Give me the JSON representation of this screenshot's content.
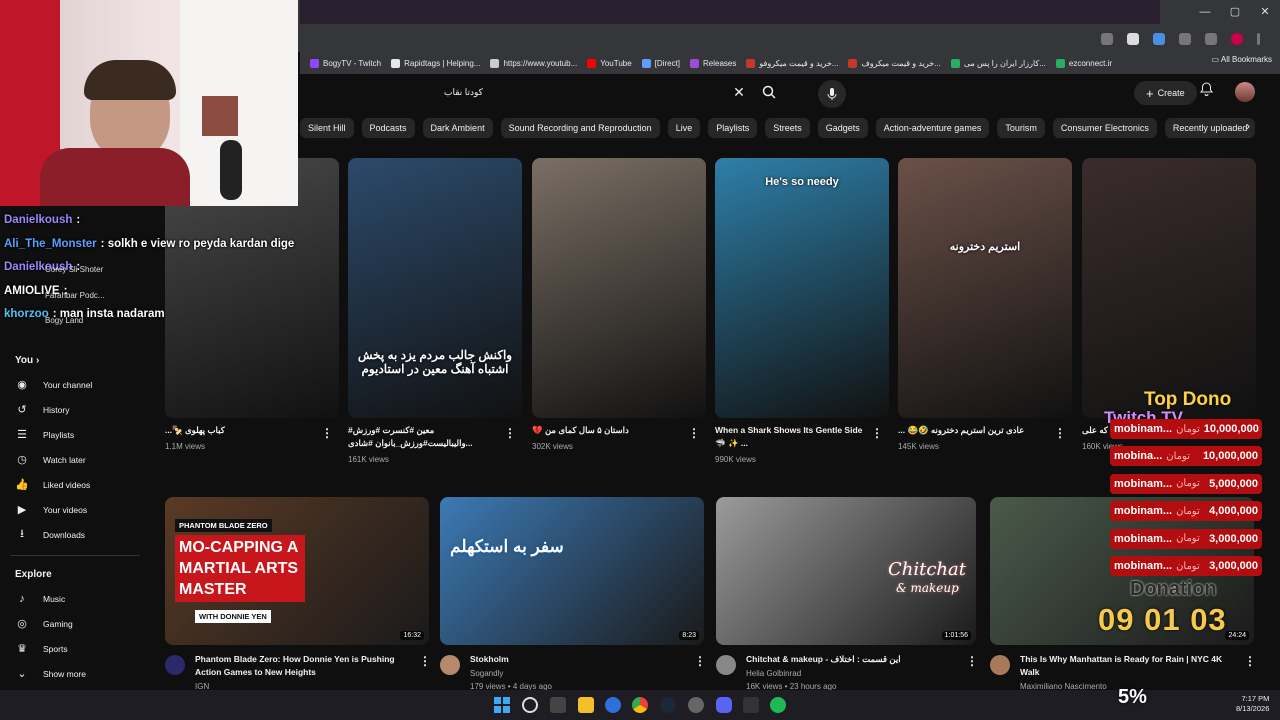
{
  "browser": {
    "bookmarks": [
      "BogyTV - Twitch",
      "Rapidtags | Helping...",
      "https://www.youtub...",
      "YouTube",
      "[Direct]",
      "Releases",
      "خرید و قیمت میکروفو...",
      "خرید و قیمت میکروف...",
      "کارزار ایران را پس می...",
      "ezconnect.ir"
    ],
    "all_bookmarks": "All Bookmarks",
    "bookmark_colors": [
      "#9146ff",
      "#e8e8e8",
      "#cccccc",
      "#ff0000",
      "#5f9cff",
      "#9c4dd3",
      "#c0392b",
      "#c0392b",
      "#27ae60",
      "#27ae60"
    ]
  },
  "youtube": {
    "search_query": "کودتا نقاب",
    "create_label": "Create",
    "chips": [
      "Silent Hill",
      "Podcasts",
      "Dark Ambient",
      "Sound Recording and Reproduction",
      "Live",
      "Playlists",
      "Streets",
      "Gadgets",
      "Action-adventure games",
      "Tourism",
      "Consumer Electronics",
      "Recently uploaded",
      "W"
    ],
    "sidebar": {
      "you_label": "You",
      "you_items": [
        {
          "label": "Your channel",
          "icon": "person-icon"
        },
        {
          "label": "History",
          "icon": "history-icon"
        },
        {
          "label": "Playlists",
          "icon": "playlist-icon"
        },
        {
          "label": "Watch later",
          "icon": "clock-icon"
        },
        {
          "label": "Liked videos",
          "icon": "thumbs-up-icon"
        },
        {
          "label": "Your videos",
          "icon": "video-icon"
        },
        {
          "label": "Downloads",
          "icon": "download-icon"
        }
      ],
      "explore_label": "Explore",
      "explore_items": [
        {
          "label": "Music",
          "icon": "music-icon"
        },
        {
          "label": "Gaming",
          "icon": "gaming-icon"
        },
        {
          "label": "Sports",
          "icon": "trophy-icon"
        },
        {
          "label": "Show more",
          "icon": "chevron-down-icon"
        }
      ],
      "subs_partial": [
        "Corey Sli Shoter",
        "Farahbar Podc...",
        "Bogy Land"
      ]
    },
    "shorts": [
      {
        "title": "کباب پهلوی 🍢...",
        "views": "1.1M views",
        "color": "#4a4a4a"
      },
      {
        "title": "معین #کنسرت #ورزش# ...والیبالیست#ورزش_بانوان #شادی #پایبزی",
        "views": "161K views",
        "color": "#2c4a6b",
        "overlay": "واکنش جالب مردم یزد به پخش اشتباه آهنگ معین در استادیوم"
      },
      {
        "title": "داستان ۵ سال کمای من 💔",
        "views": "302K views",
        "color": "#7a6f64"
      },
      {
        "title": "When a Shark Shows Its Gentle Side 🦈 ✨ ...",
        "views": "990K views",
        "color": "#2e7fa8",
        "overlay": "He's so needy"
      },
      {
        "title": "عادی ترین استریم دخترونه 🤣😂 ...",
        "views": "145K views",
        "color": "#6b5148",
        "overlay": "استریم دخترونه"
      },
      {
        "title": "که علی",
        "views": "160K views",
        "color": "#3a2c2c"
      }
    ],
    "videos": [
      {
        "title": "Phantom Blade Zero: How Donnie Yen is Pushing Action Games to New Heights",
        "channel": "IGN",
        "meta": "",
        "duration": "16:32",
        "color": "#5a3a24",
        "t1": "PHANTOM BLADE ZERO",
        "t2": "MO-CAPPING A MARTIAL ARTS MASTER",
        "t3": "WITH DONNIE YEN"
      },
      {
        "title": "Stokholm",
        "channel": "Sogandly",
        "meta": "179 views • 4 days ago",
        "duration": "8:23",
        "color": "#3c7ab5",
        "t1": "سفر به استکهلم",
        "t2": "",
        "t3": ""
      },
      {
        "title": "Chitchat & makeup - این قسمت : اختلاف",
        "channel": "Helia Golbinrad",
        "meta": "16K views • 23 hours ago",
        "duration": "1:01:56",
        "color": "#9b9b9b",
        "t1": "Chitchat",
        "t2": "& makeup",
        "t3": ""
      },
      {
        "title": "This Is Why Manhattan is Ready for Rain | NYC 4K Walk",
        "channel": "Maximiliano Nascimento",
        "meta": "",
        "duration": "24:24",
        "color": "#4a5a4a",
        "t1": "",
        "t2": "",
        "t3": ""
      }
    ]
  },
  "stream_overlay": {
    "chat": [
      {
        "user": "Danielkoush",
        "msg": ":",
        "color": "#9b87ff"
      },
      {
        "user": "Ali_The_Monster",
        "msg": ": solkh e view ro peyda kardan dige",
        "color": "#5aa0ff"
      },
      {
        "user": "Danielkoush",
        "msg": ":",
        "color": "#9b87ff"
      },
      {
        "user": "AMIOLIVE",
        "msg": ":",
        "color": "#ffffff"
      },
      {
        "user": "khorzoo",
        "msg": ": man insta nadaram",
        "color": "#4fc3f7"
      }
    ],
    "top_dono_label": "Top Dono",
    "top_dono_name": "Twitch TV",
    "donors": [
      {
        "name": "mobinam...",
        "currency": "تومان",
        "amount": "10,000,000"
      },
      {
        "name": "mobina...",
        "currency": "تومان",
        "amount": "10,000,000"
      },
      {
        "name": "mobinam...",
        "currency": "تومان",
        "amount": "5,000,000"
      },
      {
        "name": "mobinam...",
        "currency": "تومان",
        "amount": "4,000,000"
      },
      {
        "name": "mobinam...",
        "currency": "تومان",
        "amount": "3,000,000"
      },
      {
        "name": "mobinam...",
        "currency": "تومان",
        "amount": "3,000,000"
      }
    ],
    "timer": "09 01 03",
    "donation_label": "Donation",
    "battery": "5%"
  },
  "taskbar": {
    "time": "7:17 PM",
    "date": "8/13/2026"
  }
}
